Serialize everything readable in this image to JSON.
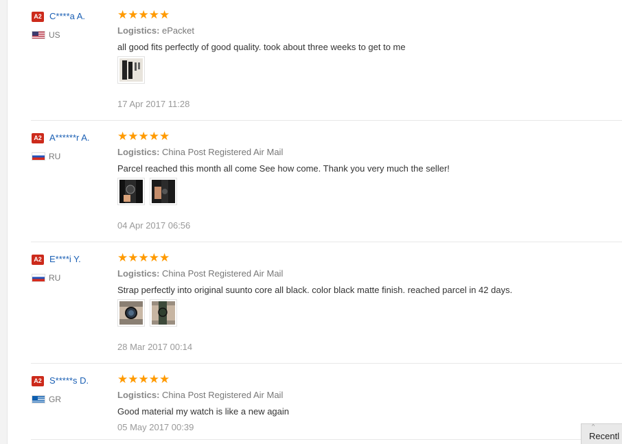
{
  "feedbacks": [
    {
      "level": "A2",
      "user": "C****a A.",
      "country": "US",
      "flag": "flag-us",
      "stars": "★★★★★",
      "logistics_label": "Logistics:",
      "logistics": "ePacket",
      "text": "all good fits perfectly of good quality. took about three weeks to get to me",
      "photo_count": 1,
      "date": "17 Apr 2017 11:28"
    },
    {
      "level": "A2",
      "user": "A******r A.",
      "country": "RU",
      "flag": "flag-ru",
      "stars": "★★★★★",
      "logistics_label": "Logistics:",
      "logistics": "China Post Registered Air Mail",
      "text": "Parcel reached this month all come See how come. Thank you very much the seller!",
      "photo_count": 2,
      "date": "04 Apr 2017 06:56"
    },
    {
      "level": "A2",
      "user": "E****i Y.",
      "country": "RU",
      "flag": "flag-ru",
      "stars": "★★★★★",
      "logistics_label": "Logistics:",
      "logistics": "China Post Registered Air Mail",
      "text": "Strap perfectly into original suunto core all black. color black matte finish. reached parcel in 42 days.",
      "photo_count": 2,
      "date": "28 Mar 2017 00:14"
    },
    {
      "level": "A2",
      "user": "S*****s D.",
      "country": "GR",
      "flag": "flag-gr",
      "stars": "★★★★★",
      "logistics_label": "Logistics:",
      "logistics": "China Post Registered Air Mail",
      "text": "Good material my watch is like a new again",
      "photo_count": 0,
      "date": "05 May 2017 00:39"
    }
  ],
  "recently_viewed": {
    "label": "Recentl",
    "arrow": "^"
  },
  "colors": {
    "stars": "#ff9a00",
    "username": "#1a5fb4",
    "badge": "#cc2a1b"
  }
}
